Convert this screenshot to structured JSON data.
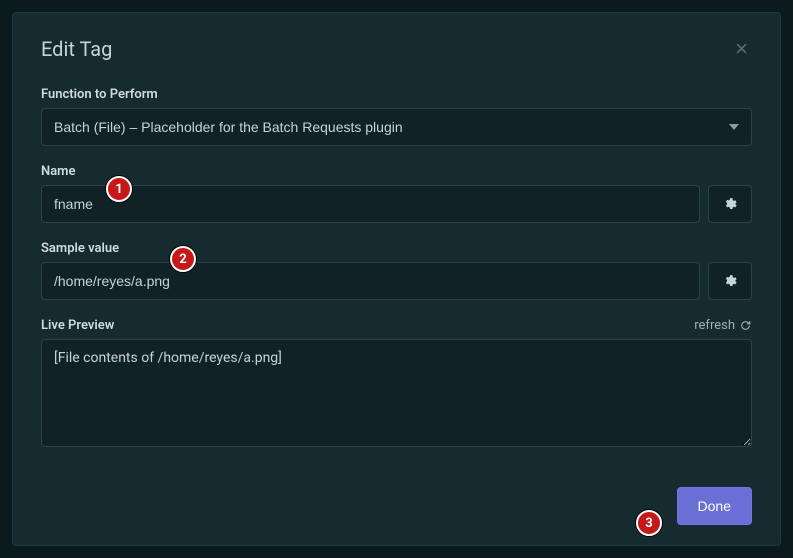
{
  "modal": {
    "title": "Edit Tag",
    "function_label": "Function to Perform",
    "function_value": "Batch (File) – Placeholder for the Batch Requests plugin",
    "name_label": "Name",
    "name_value": "fname",
    "sample_label": "Sample value",
    "sample_value": "/home/reyes/a.png",
    "preview_label": "Live Preview",
    "refresh_label": "refresh",
    "preview_value": "[File contents of /home/reyes/a.png]",
    "done_label": "Done"
  },
  "markers": {
    "m1": "1",
    "m2": "2",
    "m3": "3"
  }
}
